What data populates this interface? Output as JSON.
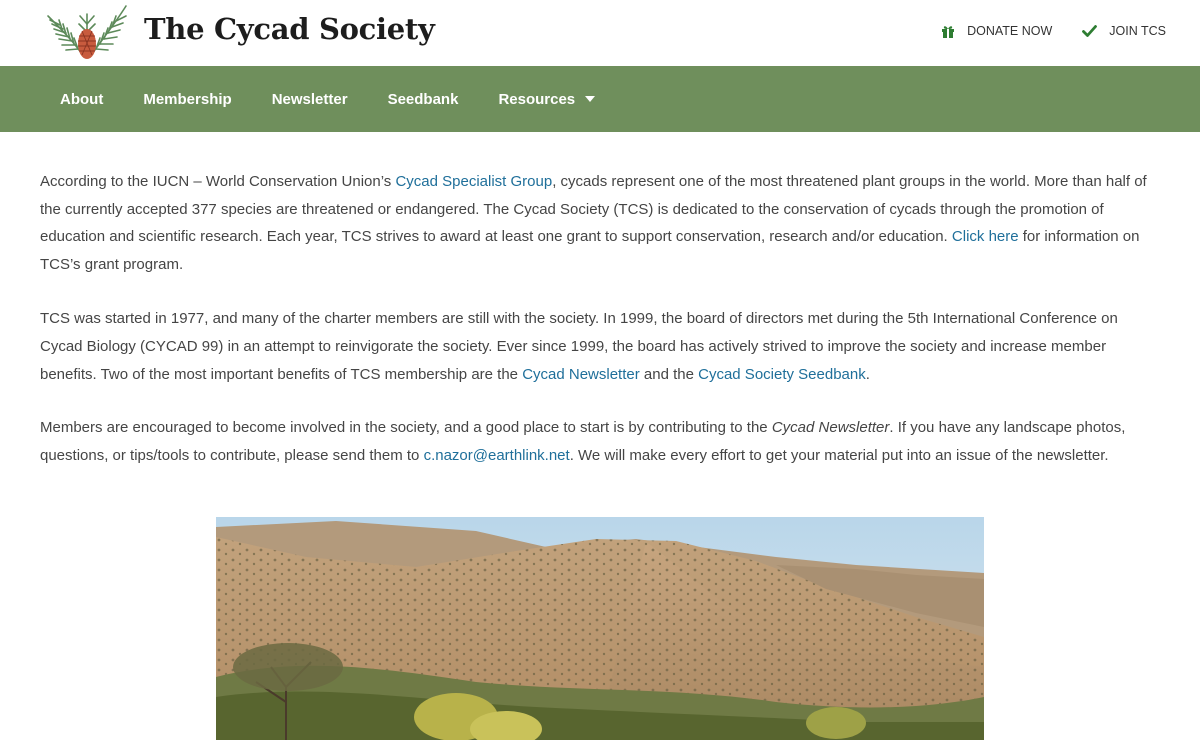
{
  "site": {
    "title": "The Cycad Society"
  },
  "top_links": {
    "donate": "DONATE NOW",
    "join": "JOIN TCS"
  },
  "nav": {
    "items": [
      {
        "label": "About"
      },
      {
        "label": "Membership"
      },
      {
        "label": "Newsletter"
      },
      {
        "label": "Seedbank"
      },
      {
        "label": "Resources"
      }
    ]
  },
  "content": {
    "p1": {
      "t1": "According to the IUCN – World Conservation Union’s ",
      "link1": "Cycad Specialist Group",
      "t2": ", cycads represent one of the most threatened plant groups in the world. More than half of the currently accepted 377 species are threatened or endangered. The Cycad Society (TCS) is dedicated to the conservation of cycads through the promotion of education and scientific research. Each year, TCS strives to award at least one grant to support conservation, research and/or education. ",
      "link2": "Click here",
      "t3": " for information on TCS’s grant program."
    },
    "p2": {
      "t1": "TCS was started in 1977, and many of the charter members are still with the society. In 1999, the board of directors met during the 5th International Conference on Cycad Biology (CYCAD 99) in an attempt to reinvigorate the society. Ever since 1999, the board has actively strived to improve the society and increase member benefits. Two of the most important benefits of TCS membership are the ",
      "link1": "Cycad Newsletter",
      "t2": " and the ",
      "link2": "Cycad Society Seedbank",
      "t3": "."
    },
    "p3": {
      "t1": "Members are encouraged to become involved in the society, and a good place to start is by contributing to the ",
      "italic": "Cycad Newsletter",
      "t2": ". If you have any landscape photos, questions, or tips/tools to contribute, please send them to ",
      "email": "c.nazor@earthlink.net",
      "t3": ". We will make every effort to get your material put into an issue of the newsletter."
    }
  },
  "colors": {
    "nav_bg": "#6f8f5c",
    "link": "#1f6f9a",
    "icon_green": "#2e7d32"
  },
  "icons": {
    "donate": "gift-icon",
    "join": "checkmark-icon",
    "resources_dropdown": "caret-down-icon"
  }
}
